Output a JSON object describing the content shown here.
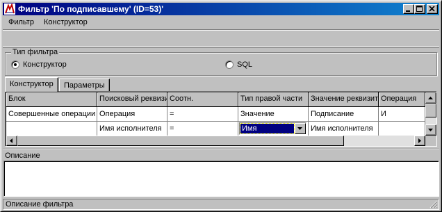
{
  "window": {
    "title": "Фильтр 'По подписавшему' (ID=53)'"
  },
  "menu": {
    "items": [
      "Фильтр",
      "Конструктор"
    ]
  },
  "filter_type": {
    "legend": "Тип фильтра",
    "options": [
      {
        "label": "Конструктор",
        "checked": true
      },
      {
        "label": "SQL",
        "checked": false
      }
    ]
  },
  "tabs": [
    "Конструктор",
    "Параметры"
  ],
  "grid": {
    "columns": [
      "Блок",
      "Поисковый реквизит",
      "Соотн.",
      "Тип правой части",
      "Значение реквизита",
      "Операция"
    ],
    "rows": [
      [
        "Совершенные операции",
        "Операция",
        "=",
        "Значение",
        "Подписание",
        "И"
      ],
      [
        "",
        "Имя исполнителя",
        "=",
        "Имя",
        "Имя исполнителя",
        ""
      ]
    ]
  },
  "description": {
    "label": "Описание",
    "text": ""
  },
  "status": {
    "text": "Описание фильтра"
  },
  "colors": {
    "title_start": "#000080",
    "title_end": "#1084d0",
    "face": "#c0c0c0",
    "selection": "#000080"
  },
  "icons": [
    "app-icon",
    "minimize-icon",
    "maximize-icon",
    "close-icon",
    "chevron-down-icon",
    "scroll-up-icon",
    "scroll-down-icon",
    "scroll-left-icon",
    "scroll-right-icon",
    "size-grip-icon"
  ]
}
